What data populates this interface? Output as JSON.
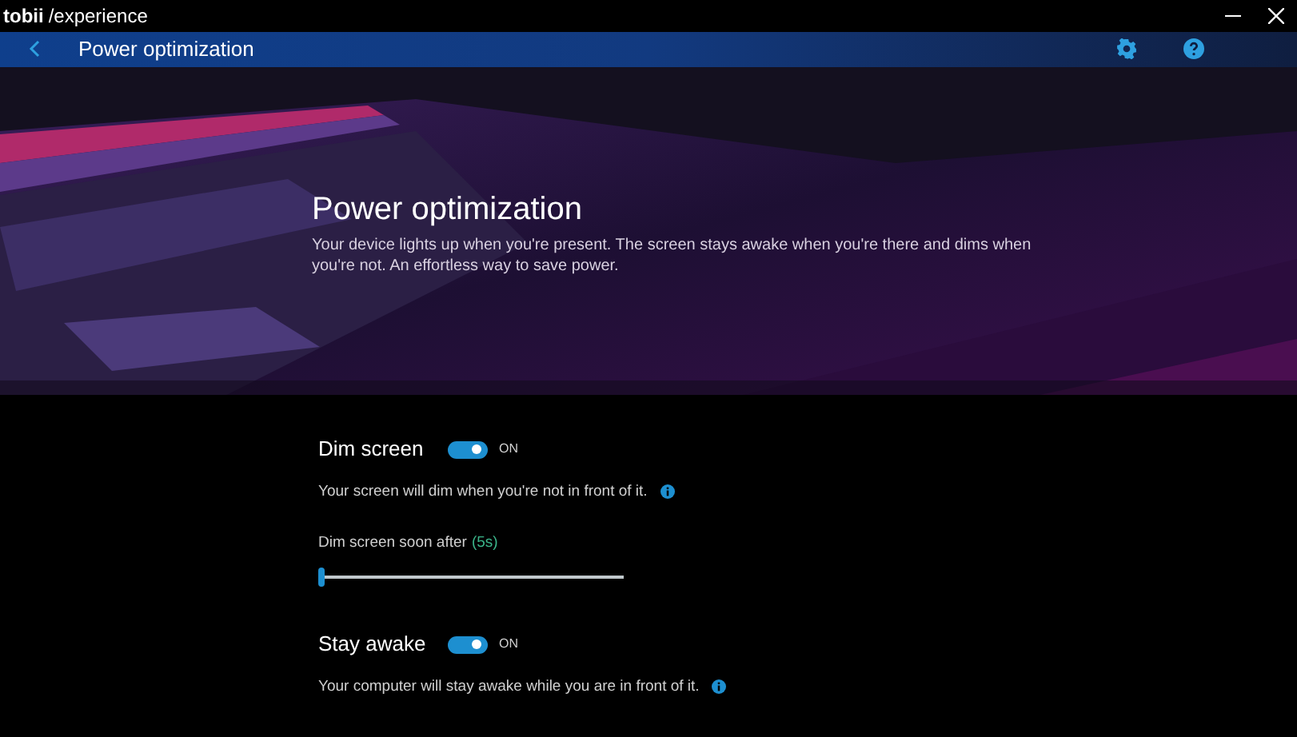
{
  "window": {
    "brand": "tobii",
    "product": "/experience"
  },
  "nav": {
    "title": "Power optimization"
  },
  "hero": {
    "title": "Power optimization",
    "description": "Your device lights up when you're present. The screen stays awake when you're there and dims when you're not. An effortless way to save power."
  },
  "settings": [
    {
      "kind": "toggle",
      "label": "Dim screen",
      "on": true,
      "state_text": "ON",
      "description": "Your screen will dim when you're not in front of it."
    },
    {
      "kind": "slider",
      "label": "Dim screen soon after",
      "value": "(5s)",
      "level": 0.0
    },
    {
      "kind": "toggle",
      "label": "Stay awake",
      "on": true,
      "state_text": "ON",
      "description": "Your computer will stay awake while you are in front of it."
    }
  ]
}
